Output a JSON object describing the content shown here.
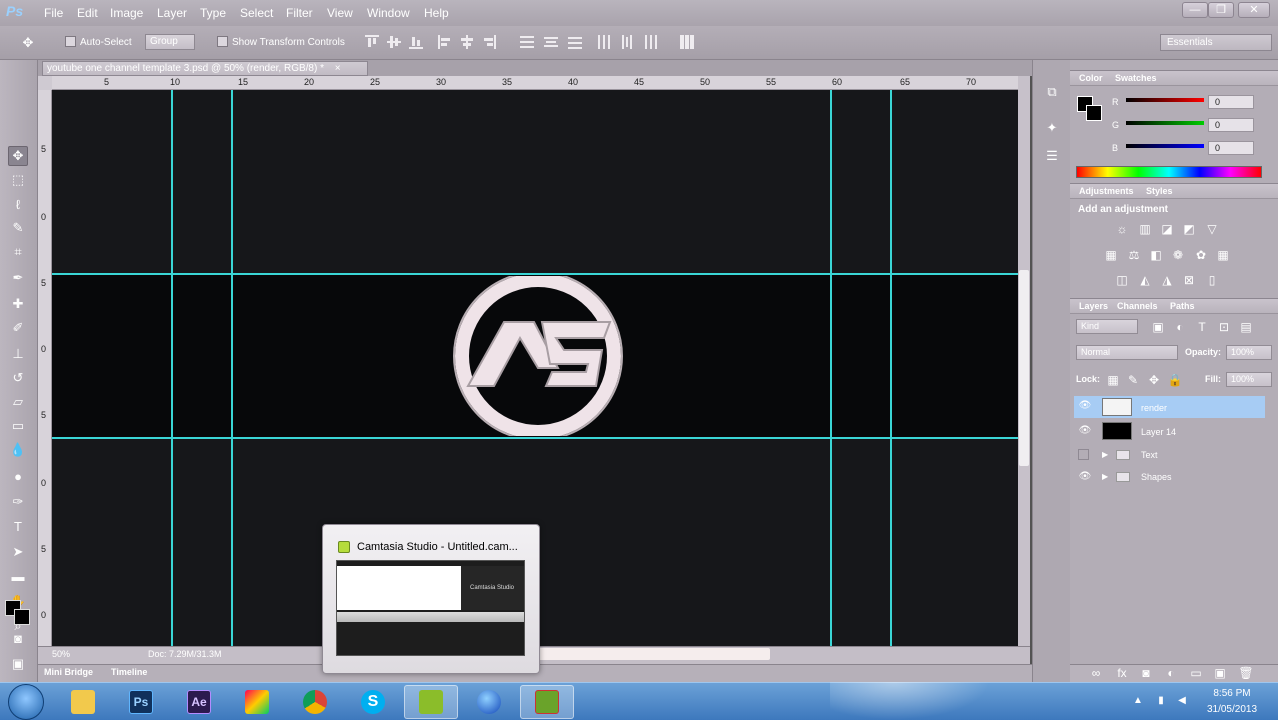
{
  "app": {
    "logo": "Ps",
    "menu": [
      "File",
      "Edit",
      "Image",
      "Layer",
      "Type",
      "Select",
      "Filter",
      "View",
      "Window",
      "Help"
    ],
    "window_controls": [
      "—",
      "❐",
      "✕"
    ]
  },
  "options_bar": {
    "auto_select_label": "Auto-Select",
    "auto_select_target": "Group",
    "transform_controls_label": "Show Transform Controls",
    "workspace": "Essentials"
  },
  "document": {
    "tab_title": "youtube one channel template 3.psd @ 50% (render, RGB/8) *",
    "tab_close": "×",
    "zoom": "50%",
    "doc_size": "Doc: 7.29M/31.3M"
  },
  "rulers": {
    "horizontal": [
      "5",
      "10",
      "15",
      "20",
      "25",
      "30",
      "35",
      "40",
      "45",
      "50",
      "55",
      "60",
      "65",
      "70"
    ],
    "vertical": [
      "5",
      "0",
      "5",
      "0",
      "5",
      "0",
      "5",
      "0",
      "5",
      "0"
    ]
  },
  "bottom_tabs": [
    "Mini Bridge",
    "Timeline"
  ],
  "color_panel": {
    "tabs": [
      "Color",
      "Swatches"
    ],
    "channels": [
      {
        "label": "R",
        "value": "0",
        "color": "#ff0000"
      },
      {
        "label": "G",
        "value": "0",
        "color": "#00cc00"
      },
      {
        "label": "B",
        "value": "0",
        "color": "#0000ff"
      }
    ]
  },
  "adjustments_panel": {
    "tabs": [
      "Adjustments",
      "Styles"
    ],
    "heading": "Add an adjustment"
  },
  "layers_panel": {
    "tabs": [
      "Layers",
      "Channels",
      "Paths"
    ],
    "filter_kind": "Kind",
    "blend_mode": "Normal",
    "opacity_label": "Opacity:",
    "opacity": "100%",
    "lock_label": "Lock:",
    "fill_label": "Fill:",
    "fill": "100%",
    "layers": [
      {
        "name": "render",
        "type": "layer",
        "visible": true,
        "selected": true
      },
      {
        "name": "Layer 14",
        "type": "layer",
        "visible": true,
        "selected": false
      },
      {
        "name": "Text",
        "type": "group",
        "visible": false,
        "selected": false
      },
      {
        "name": "Shapes",
        "type": "group",
        "visible": true,
        "selected": false
      }
    ]
  },
  "taskbar_popup": {
    "title": "Camtasia Studio - Untitled.cam...",
    "thumb_caption": "Camtasia Studio"
  },
  "taskbar": {
    "apps": [
      "Explorer",
      "Ps",
      "Ae",
      "Paint",
      "Chrome",
      "Skype",
      "Camtasia",
      "Globe",
      "Camtasia Recorder"
    ],
    "time": "8:56 PM",
    "date": "31/05/2013",
    "tray_arrow": "▲"
  },
  "colors": {
    "guide": "#3ad6d6",
    "canvas": "#16171a",
    "banner": "#07080a",
    "logo_fill": "#efe3e8",
    "selected_layer": "#a7ccf4"
  }
}
